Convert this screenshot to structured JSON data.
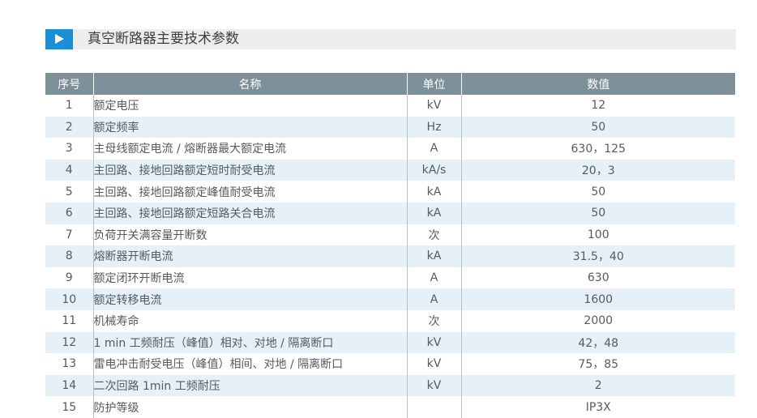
{
  "title": "真空断路器主要技术参数",
  "table": {
    "headers": [
      "序号",
      "名称",
      "单位",
      "数值"
    ],
    "rows": [
      {
        "no": "1",
        "name": "额定电压",
        "unit": "kV",
        "value": "12"
      },
      {
        "no": "2",
        "name": "额定频率",
        "unit": "Hz",
        "value": "50"
      },
      {
        "no": "3",
        "name": "主母线额定电流 / 熔断器最大额定电流",
        "unit": "A",
        "value": "630，125"
      },
      {
        "no": "4",
        "name": "主回路、接地回路额定短时耐受电流",
        "unit": "kA/s",
        "value": "20，3"
      },
      {
        "no": "5",
        "name": "主回路、接地回路额定峰值耐受电流",
        "unit": "kA",
        "value": "50"
      },
      {
        "no": "6",
        "name": "主回路、接地回路额定短路关合电流",
        "unit": "kA",
        "value": "50"
      },
      {
        "no": "7",
        "name": "负荷开关满容量开断数",
        "unit": "次",
        "value": "100"
      },
      {
        "no": "8",
        "name": "熔断器开断电流",
        "unit": "kA",
        "value": "31.5，40"
      },
      {
        "no": "9",
        "name": "额定闭环开断电流",
        "unit": "A",
        "value": "630"
      },
      {
        "no": "10",
        "name": "额定转移电流",
        "unit": "A",
        "value": "1600"
      },
      {
        "no": "11",
        "name": "机械寿命",
        "unit": "次",
        "value": "2000"
      },
      {
        "no": "12",
        "name": "1 min 工频耐压（峰值）相对、对地 / 隔离断口",
        "unit": "kV",
        "value": "42，48"
      },
      {
        "no": "13",
        "name": "雷电冲击耐受电压（峰值）相间、对地 / 隔离断口",
        "unit": "kV",
        "value": "75，85"
      },
      {
        "no": "14",
        "name": "二次回路 1min 工频耐压",
        "unit": "kV",
        "value": "2"
      },
      {
        "no": "15",
        "name": "防护等级",
        "unit": "",
        "value": "IP3X"
      }
    ]
  },
  "colors": {
    "accent": "#1a8fd6",
    "header_bg": "#7d8f99",
    "stripe_bg": "#e6f1f7",
    "title_bar_bg": "#ededed"
  },
  "icons": {
    "title_icon": "play-triangle-icon"
  }
}
